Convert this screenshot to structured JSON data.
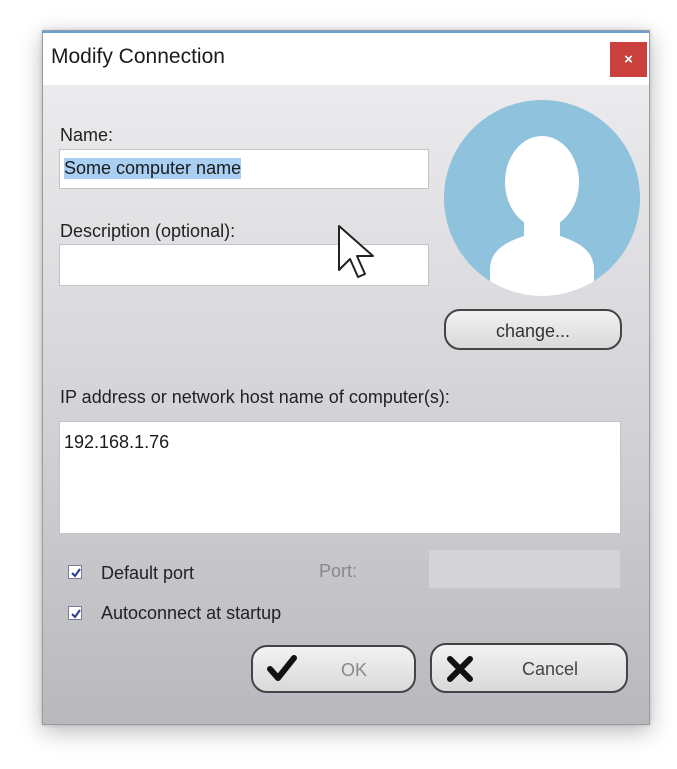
{
  "dialog": {
    "title": "Modify Connection",
    "close_label": "×"
  },
  "form": {
    "name_label": "Name:",
    "name_value": "Some computer name",
    "description_label": "Description (optional):",
    "description_value": "",
    "change_label": "change...",
    "address_label": "IP address or network host name of computer(s):",
    "address_value": "192.168.1.76",
    "default_port_label": "Default port",
    "default_port_checked": true,
    "port_label": "Port:",
    "port_value": "",
    "autoconnect_label": "Autoconnect at startup",
    "autoconnect_checked": true
  },
  "buttons": {
    "ok_label": "OK",
    "cancel_label": "Cancel"
  },
  "icons": {
    "avatar": "user-silhouette-icon",
    "ok": "checkmark-icon",
    "cancel": "x-icon",
    "cursor": "mouse-pointer-icon"
  },
  "colors": {
    "close_button": "#c9403d",
    "avatar_bg": "#8fc2dc",
    "selection": "#a9cff2"
  }
}
